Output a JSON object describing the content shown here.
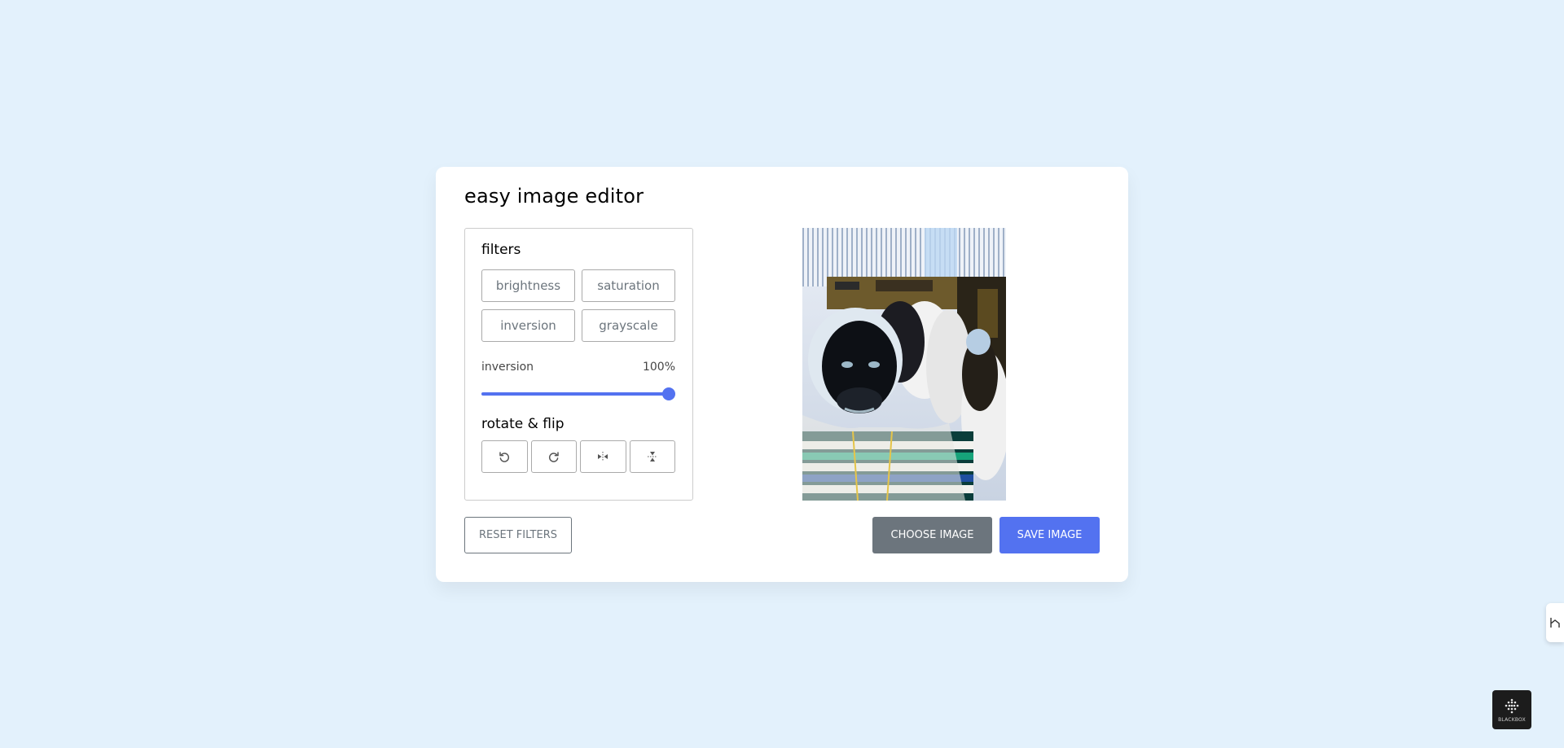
{
  "app": {
    "title": "easy image editor"
  },
  "filters": {
    "section_label": "filters",
    "options": [
      {
        "label": "brightness"
      },
      {
        "label": "saturation"
      },
      {
        "label": "inversion"
      },
      {
        "label": "grayscale"
      }
    ],
    "active_name": "inversion",
    "active_value_text": "100%",
    "active_value_fraction": 1.0
  },
  "rotate": {
    "section_label": "rotate & flip",
    "buttons": [
      {
        "icon": "rotate-left-icon"
      },
      {
        "icon": "rotate-right-icon"
      },
      {
        "icon": "flip-horizontal-icon"
      },
      {
        "icon": "flip-vertical-icon"
      }
    ]
  },
  "actions": {
    "reset_label": "Reset Filters",
    "choose_label": "Choose Image",
    "save_label": "Save Image"
  },
  "widgets": {
    "side_tab_icon": "extension-handle-icon",
    "badge_icon": "blackbox-logo-icon",
    "badge_text": "BLACKBOX"
  },
  "colors": {
    "background": "#e3f1fc",
    "accent": "#5372f0",
    "secondary": "#6c757d"
  }
}
